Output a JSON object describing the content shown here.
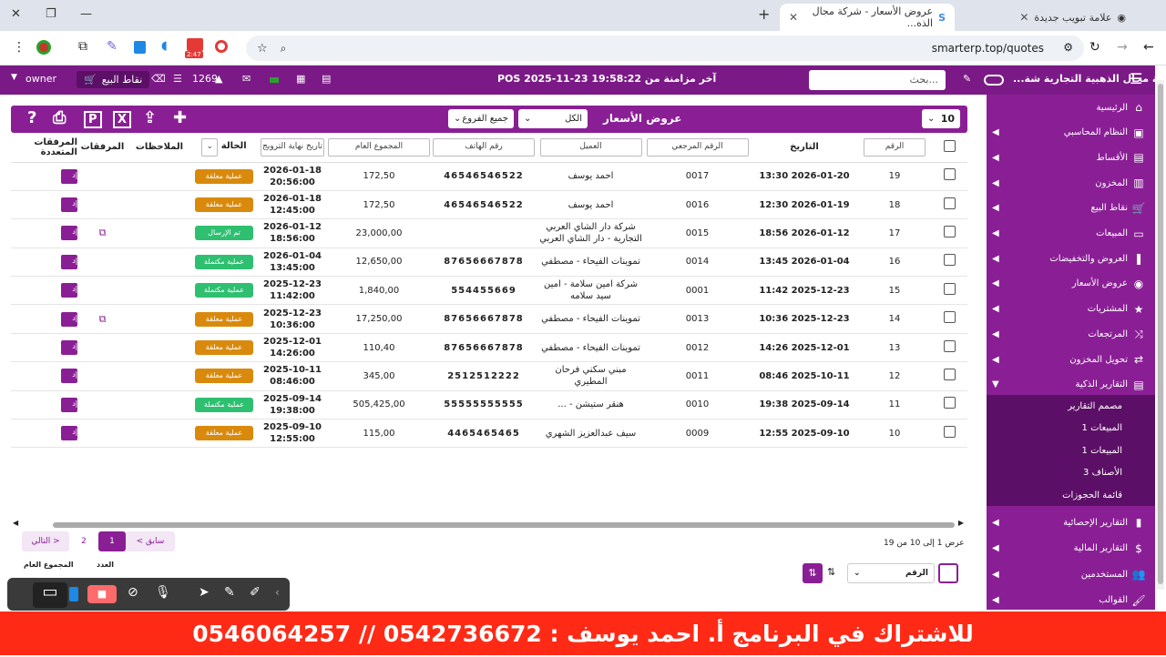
{
  "browser": {
    "tab_new": "علامة تبويب جديدة",
    "tab_active": "عروض الأسعار - شركة مجال الذه...",
    "url": "smarterp.top/quotes",
    "badge": "2:47"
  },
  "topbar": {
    "company": "شركة مجال الذهبية التجارية شة...",
    "search_placeholder": "بحث...",
    "sync": "آخر مزامنة من POS 2025-11-23 19:58:22",
    "count": "1269",
    "pos": "نقاط البيع",
    "user": "owner"
  },
  "sidebar": {
    "items": [
      {
        "label": "الرئيسية",
        "icon": "home-icon"
      },
      {
        "label": "النظام المحاسبي",
        "icon": "accounting-icon"
      },
      {
        "label": "الأقساط",
        "icon": "installments-icon"
      },
      {
        "label": "المخزون",
        "icon": "inventory-icon"
      },
      {
        "label": "نقاط البيع",
        "icon": "cart-icon"
      },
      {
        "label": "المبيعات",
        "icon": "card-icon"
      },
      {
        "label": "العروض والتخفيضات",
        "icon": "bookmark-icon"
      },
      {
        "label": "عروض الأسعار",
        "icon": "quote-icon"
      },
      {
        "label": "المشتريات",
        "icon": "star-icon"
      },
      {
        "label": "المرتجعات",
        "icon": "shuffle-icon"
      },
      {
        "label": "تحويل المخزون",
        "icon": "transfer-icon"
      },
      {
        "label": "التقارير الذكية",
        "icon": "report-icon"
      }
    ],
    "sub": [
      "مصمم التقارير",
      "المبيعات 1",
      "المبيعات 1",
      "الأصناف 3",
      "قائمة الحجوزات"
    ],
    "items2": [
      {
        "label": "التقارير الإحصائية",
        "icon": "chart-icon"
      },
      {
        "label": "التقارير المالية",
        "icon": "dollar-icon"
      },
      {
        "label": "المستخدمين",
        "icon": "users-icon"
      },
      {
        "label": "القوالب",
        "icon": "brush-icon"
      }
    ]
  },
  "card": {
    "title": "عروض الأسعار",
    "per_page": "10",
    "status_filter": "الكل",
    "branch_filter": "جميع الفروع"
  },
  "table": {
    "headers": {
      "number": "الرقم",
      "date": "التاريخ",
      "ref": "الرقم المرجعي",
      "client": "العميل",
      "phone": "رقم الهاتف",
      "total": "المجموع العام",
      "expiry": "تاريخ نهاية الترويج",
      "status": "الحالة",
      "notes": "الملاحظات",
      "attachments": "المرفقات",
      "multi": "المرفقات المتعددة"
    },
    "rows": [
      {
        "n": "19",
        "date": "2026-01-20 13:30",
        "ref": "0017",
        "client": "احمد يوسف",
        "phone": "46546546522",
        "total": "172,50",
        "exp1": "2026-01-18",
        "exp2": "20:56:00",
        "status": "عملية معلقة",
        "color": "orange",
        "att": false
      },
      {
        "n": "18",
        "date": "2026-01-19 12:30",
        "ref": "0016",
        "client": "احمد يوسف",
        "phone": "46546546522",
        "total": "172,50",
        "exp1": "2026-01-18",
        "exp2": "12:45:00",
        "status": "عملية معلقة",
        "color": "orange",
        "att": false
      },
      {
        "n": "17",
        "date": "2026-01-12 18:56",
        "ref": "0015",
        "client": "شركة دار الشاي العربي التجارية - دار الشاي العربي",
        "phone": "",
        "total": "23,000,00",
        "exp1": "2026-01-12",
        "exp2": "18:56:00",
        "status": "تم الإرسال",
        "color": "green",
        "att": true
      },
      {
        "n": "16",
        "date": "2026-01-04 13:45",
        "ref": "0014",
        "client": "تموينات الفيحاء - مصطفي",
        "phone": "87656667878",
        "total": "12,650,00",
        "exp1": "2026-01-04",
        "exp2": "13:45:00",
        "status": "عملية مكتملة",
        "color": "green",
        "att": false
      },
      {
        "n": "15",
        "date": "2025-12-23 11:42",
        "ref": "0001",
        "client": "شركة امين سلامة - امين سيد سلامه",
        "phone": "554455669",
        "total": "1,840,00",
        "exp1": "2025-12-23",
        "exp2": "11:42:00",
        "status": "عملية مكتملة",
        "color": "green",
        "att": false
      },
      {
        "n": "14",
        "date": "2025-12-23 10:36",
        "ref": "0013",
        "client": "تموينات الفيحاء - مصطفي",
        "phone": "87656667878",
        "total": "17,250,00",
        "exp1": "2025-12-23",
        "exp2": "10:36:00",
        "status": "عملية معلقة",
        "color": "orange",
        "att": true
      },
      {
        "n": "13",
        "date": "2025-12-01 14:26",
        "ref": "0012",
        "client": "تموينات الفيحاء - مصطفي",
        "phone": "87656667878",
        "total": "110,40",
        "exp1": "2025-12-01",
        "exp2": "14:26:00",
        "status": "عملية معلقة",
        "color": "orange",
        "att": false
      },
      {
        "n": "12",
        "date": "2025-10-11 08:46",
        "ref": "0011",
        "client": "مبني سكني فرحان المطيري",
        "phone": "2512512222",
        "total": "345,00",
        "exp1": "2025-10-11",
        "exp2": "08:46:00",
        "status": "عملية معلقة",
        "color": "orange",
        "att": false
      },
      {
        "n": "11",
        "date": "2025-09-14 19:38",
        "ref": "0010",
        "client": "هنقر ستيشن - ...",
        "phone": "55555555555",
        "total": "505,425,00",
        "exp1": "2025-09-14",
        "exp2": "19:38:00",
        "status": "عملية مكتملة",
        "color": "green",
        "att": false
      },
      {
        "n": "10",
        "date": "2025-09-10 12:55",
        "ref": "0009",
        "client": "سيف عبدالعزيز الشهري",
        "phone": "4465465465",
        "total": "115,00",
        "exp1": "2025-09-10",
        "exp2": "12:55:00",
        "status": "عملية معلقة",
        "color": "orange",
        "att": false
      }
    ],
    "edit_label": "إد"
  },
  "footer": {
    "info": "عرض 1 إلى 10 من 19",
    "prev": "< سابق",
    "page1": "1",
    "page2": "2",
    "next": "التالي >",
    "sort_field": "الرقم",
    "count_label": "العدد",
    "total_label": "المجموع العام"
  },
  "banner": "للاشتراك في البرنامج أ. احمد يوسف : 0542736672 // 0546064257",
  "colors": {
    "primary": "#8a1f95",
    "banner": "#ff2a16",
    "orange": "#d98a0c",
    "green": "#2fbf71"
  }
}
